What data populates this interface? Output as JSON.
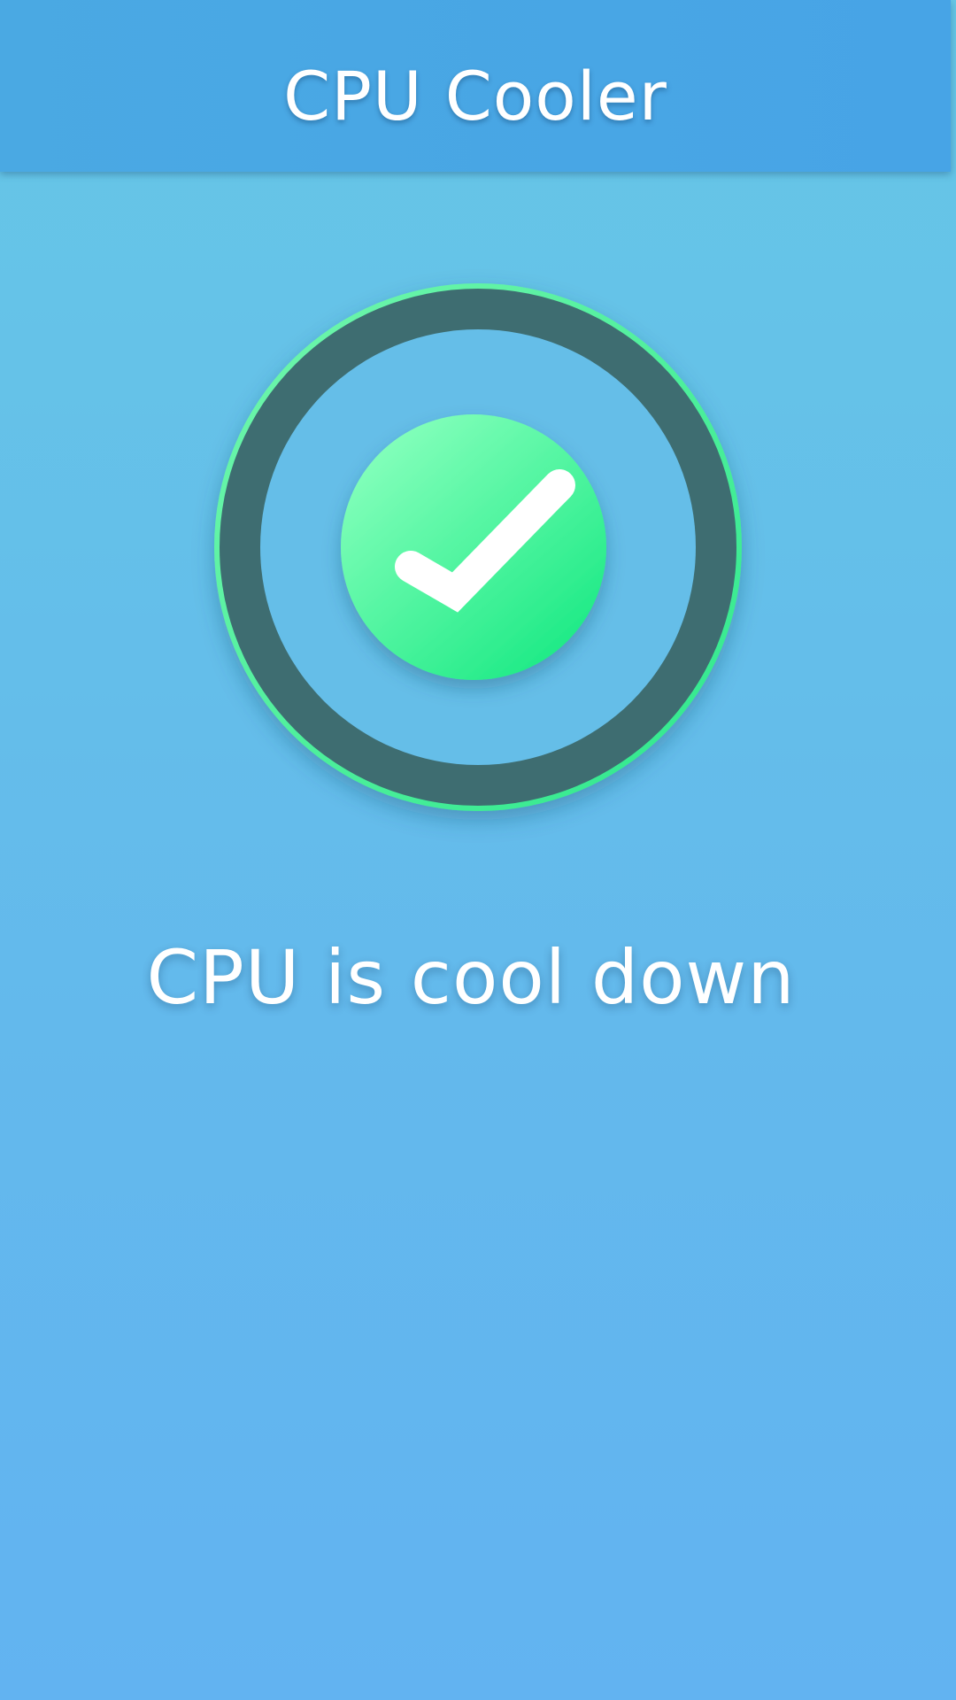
{
  "app_bar": {
    "title": "CPU Cooler"
  },
  "status": {
    "message": "CPU is cool down",
    "icon": "checkmark-icon",
    "state": "cooled"
  },
  "colors": {
    "app_bar": "#48a7e4",
    "background_top": "#66c7e6",
    "background_bottom": "#62b3f1",
    "ring_dark": "#3e6d71",
    "ring_accent_start": "#72f7ae",
    "ring_accent_end": "#2ee88c",
    "badge_start": "#84ffbb",
    "badge_end": "#1eea86",
    "text": "#ffffff"
  }
}
